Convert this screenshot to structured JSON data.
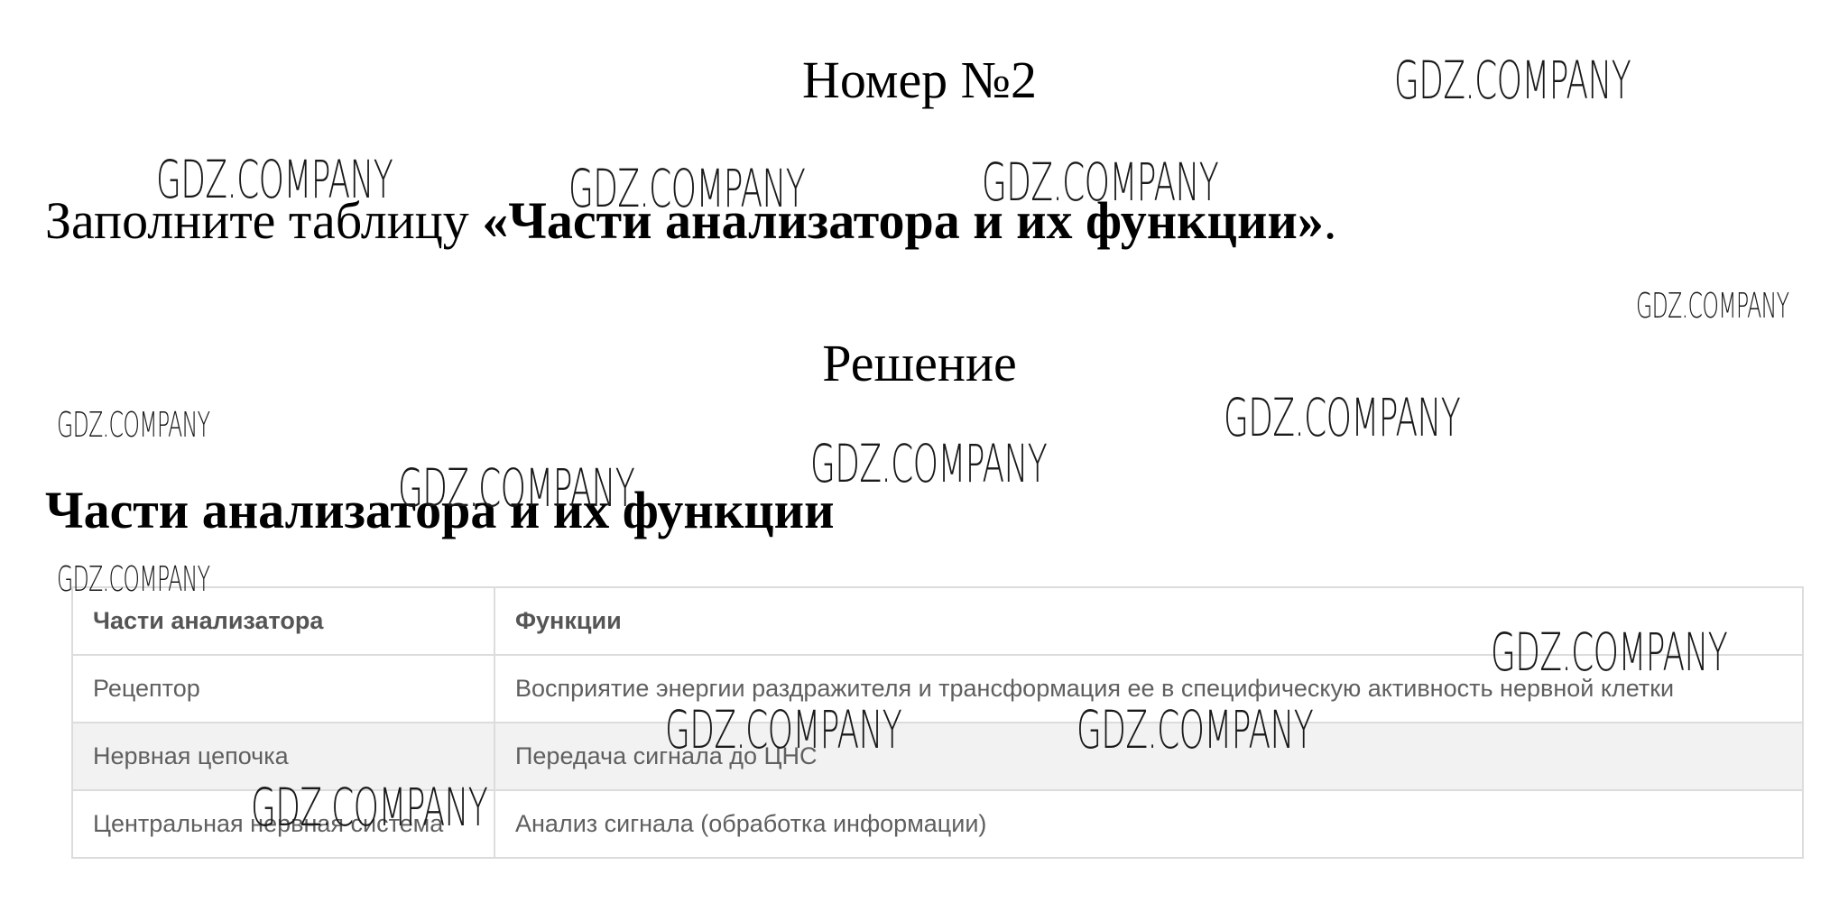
{
  "heading": "Номер №2",
  "task": {
    "prefix": "Заполните таблицу ",
    "emphasis": "«Части анализатора и их функции»",
    "suffix": "."
  },
  "solution_heading": "Решение",
  "table_title": "Части анализатора и их функции",
  "table": {
    "headers": [
      "Части анализатора",
      "Функции"
    ],
    "rows": [
      [
        "Рецептор",
        "Восприятие энергии раздражителя и трансформация ее в специфическую активность нервной клетки"
      ],
      [
        "Нервная цепочка",
        "Передача сигнала до ЦНС"
      ],
      [
        "Центральная нервная система",
        "Анализ сигнала (обработка информации)"
      ]
    ]
  },
  "watermark": "GDZ.COMPANY",
  "colors": {
    "text": "#000000",
    "table_text": "#5f5f5f",
    "table_border": "#dcdcdc",
    "row_shade": "#f2f2f2"
  }
}
